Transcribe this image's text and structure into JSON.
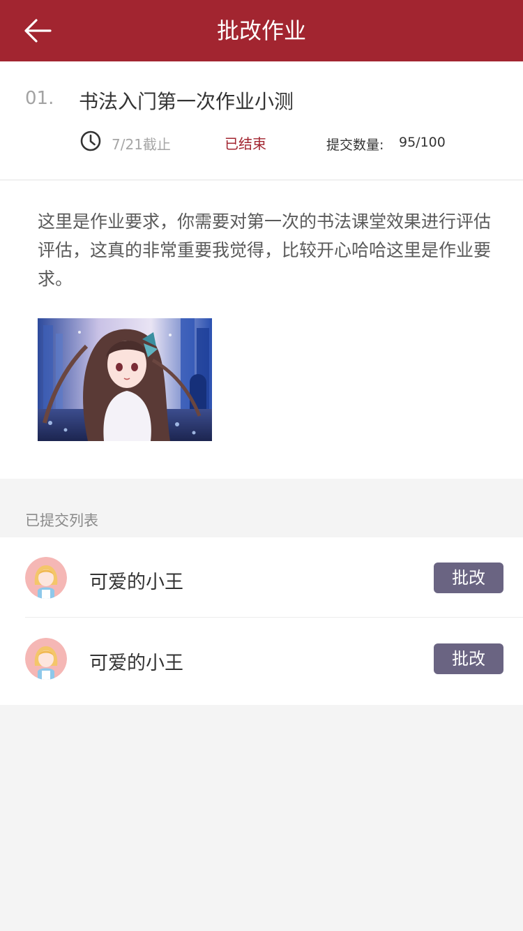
{
  "header": {
    "title": "批改作业",
    "back_icon": "arrow-left-icon"
  },
  "homework": {
    "index": "01.",
    "title": "书法入门第一次作业小测",
    "deadline": "7/21截止",
    "status": "已结束",
    "count_label": "提交数量:",
    "count_value": "95/100"
  },
  "requirement": {
    "text": "这里是作业要求，你需要对第一次的书法课堂效果进行评估评估，这真的非常重要我觉得，比较开心哈哈这里是作业要求。"
  },
  "submitted": {
    "label": "已提交列表",
    "rows": [
      {
        "name": "可爱的小王",
        "button": "批改"
      },
      {
        "name": "可爱的小王",
        "button": "批改"
      }
    ]
  },
  "colors": {
    "brand": "#a22530",
    "button": "#6a6482",
    "background": "#f4f4f4"
  }
}
